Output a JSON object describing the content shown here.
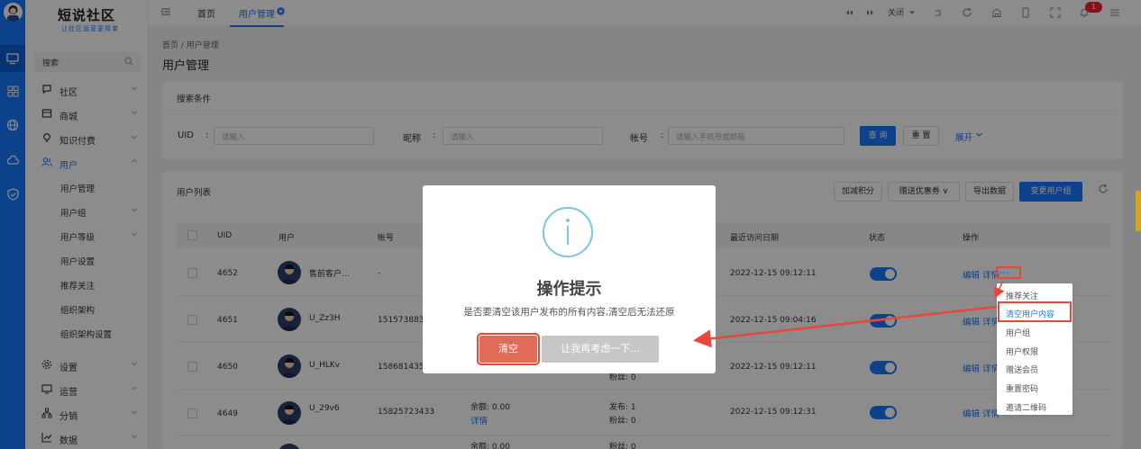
{
  "logo": {
    "title": "短说社区",
    "tagline": "让社区运营更简单"
  },
  "sidebar": {
    "search_placeholder": "搜索",
    "items": [
      {
        "label": "社区",
        "icon": "chat-icon"
      },
      {
        "label": "商城",
        "icon": "shop-icon"
      },
      {
        "label": "知识付费",
        "icon": "bulb-icon"
      },
      {
        "label": "用户",
        "icon": "users-icon"
      },
      {
        "label": "设置",
        "icon": "gear-icon"
      },
      {
        "label": "运营",
        "icon": "monitor-icon"
      },
      {
        "label": "分销",
        "icon": "sitemap-icon"
      },
      {
        "label": "数据",
        "icon": "chart-icon"
      }
    ],
    "user_sub": [
      "用户管理",
      "用户组",
      "用户等级",
      "用户设置",
      "推荐关注",
      "组织架构",
      "组织架构设置"
    ]
  },
  "topbar": {
    "tabs": [
      "首页",
      "用户管理"
    ],
    "close_label": "关闭",
    "notification_count": "1"
  },
  "breadcrumb": "首页 / 用户管理",
  "page_title": "用户管理",
  "search_panel": {
    "title": "搜索条件",
    "uid_label": "UID",
    "uid_placeholder": "请输入",
    "nick_label": "昵称",
    "nick_placeholder": "请输入",
    "account_label": "帐号",
    "account_placeholder": "请输入手机号或邮箱",
    "query_label": "查 询",
    "reset_label": "重 置",
    "expand_label": "展开"
  },
  "list_panel": {
    "title": "用户列表",
    "buttons": [
      "加减积分",
      "赠送优惠券",
      "导出数据",
      "变更用户组"
    ],
    "columns": [
      "UID",
      "用户",
      "帐号",
      "最近访问日期",
      "状态",
      "操作"
    ],
    "rows": [
      {
        "uid": "4652",
        "name": "售前客户...",
        "account": "-",
        "date": "2022-12-15 09:12:11",
        "ops": "编辑 详情"
      },
      {
        "uid": "4651",
        "name": "U_Zz3H",
        "account": "151573883",
        "date": "2022-12-15 09:04:16",
        "ops": "编辑 详情"
      },
      {
        "uid": "4650",
        "name": "U_HLKv",
        "account": "158681435",
        "date": "2022-12-15 09:12:11",
        "ops": "编辑 详情"
      },
      {
        "uid": "4649",
        "name": "U_29v6",
        "account": "15825723433",
        "balance": "余额: 0.00",
        "detail": "详情",
        "posts": "发布: 1",
        "fans": "粉丝: 0",
        "date": "2022-12-15 09:12:31",
        "ops": "编辑 详情"
      }
    ],
    "row3_fans_fragment": "粉丝: 0",
    "bottom_fragment_1": "余额: 0.00",
    "bottom_fragment_2": "粉丝: 0"
  },
  "dialog": {
    "title": "操作提示",
    "message": "是否要清空该用户发布的所有内容,清空后无法还原",
    "confirm_label": "清空",
    "cancel_label": "让我再考虑一下..."
  },
  "dropdown": {
    "more_label": "...",
    "items": [
      "推荐关注",
      "清空用户内容",
      "用户组",
      "用户权限",
      "赠送会员",
      "重置密码",
      "邀请二维码"
    ]
  },
  "colors": {
    "primary": "#1677ff",
    "danger": "#e06b57",
    "annotation": "#e8483a"
  }
}
